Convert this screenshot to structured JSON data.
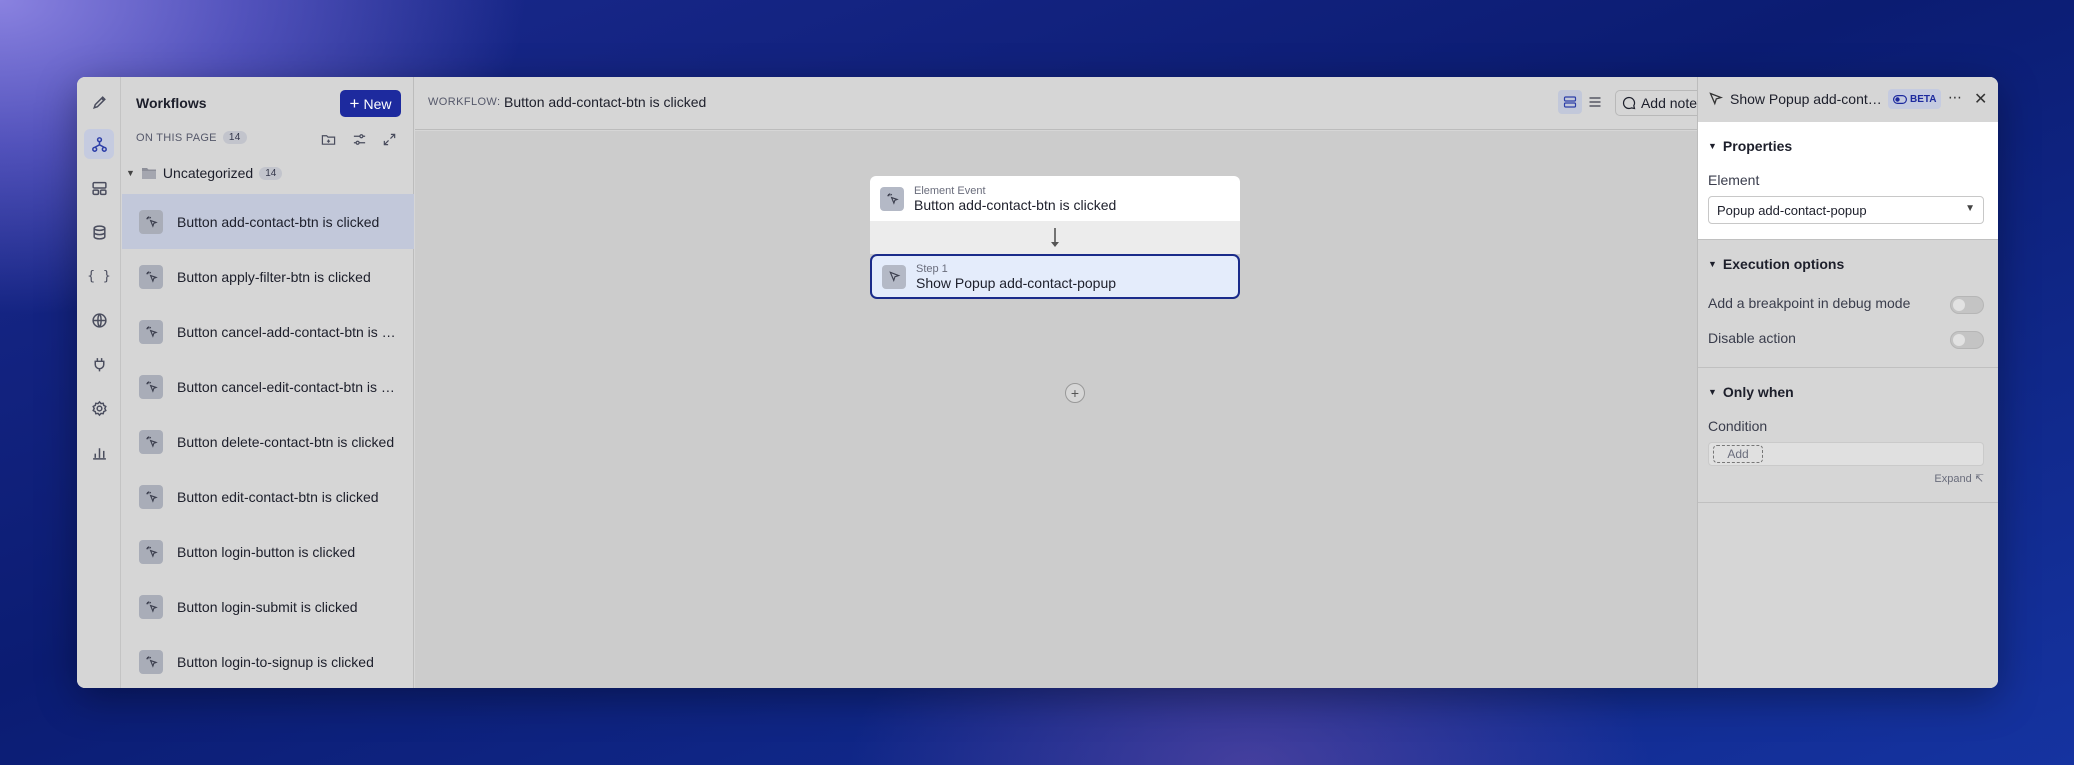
{
  "sidebar": {
    "title": "Workflows",
    "new_label": "New",
    "on_this_page": "ON THIS PAGE",
    "count": "14",
    "folder": {
      "name": "Uncategorized",
      "count": "14"
    },
    "items": [
      {
        "label": "Button add-contact-btn is clicked"
      },
      {
        "label": "Button apply-filter-btn is clicked"
      },
      {
        "label": "Button cancel-add-contact-btn is clicked"
      },
      {
        "label": "Button cancel-edit-contact-btn is clicked"
      },
      {
        "label": "Button delete-contact-btn is clicked"
      },
      {
        "label": "Button edit-contact-btn is clicked"
      },
      {
        "label": "Button login-button is clicked"
      },
      {
        "label": "Button login-submit is clicked"
      },
      {
        "label": "Button login-to-signup is clicked"
      }
    ]
  },
  "header": {
    "workflow_label": "WORKFLOW:",
    "workflow_name": "Button add-contact-btn is clicked",
    "add_notes": "Add notes"
  },
  "canvas": {
    "trigger": {
      "kind": "Element Event",
      "name": "Button add-contact-btn is clicked"
    },
    "step": {
      "kind": "Step 1",
      "name": "Show Popup add-contact-popup"
    },
    "add_symbol": "+"
  },
  "panel": {
    "title": "Show Popup add-contact-popup",
    "badge": "BETA",
    "properties": {
      "title": "Properties",
      "element_label": "Element",
      "element_value": "Popup add-contact-popup"
    },
    "execution": {
      "title": "Execution options",
      "breakpoint": "Add a breakpoint in debug mode",
      "disable": "Disable action"
    },
    "only_when": {
      "title": "Only when",
      "condition_label": "Condition",
      "add": "Add",
      "expand": "Expand ↸"
    }
  }
}
